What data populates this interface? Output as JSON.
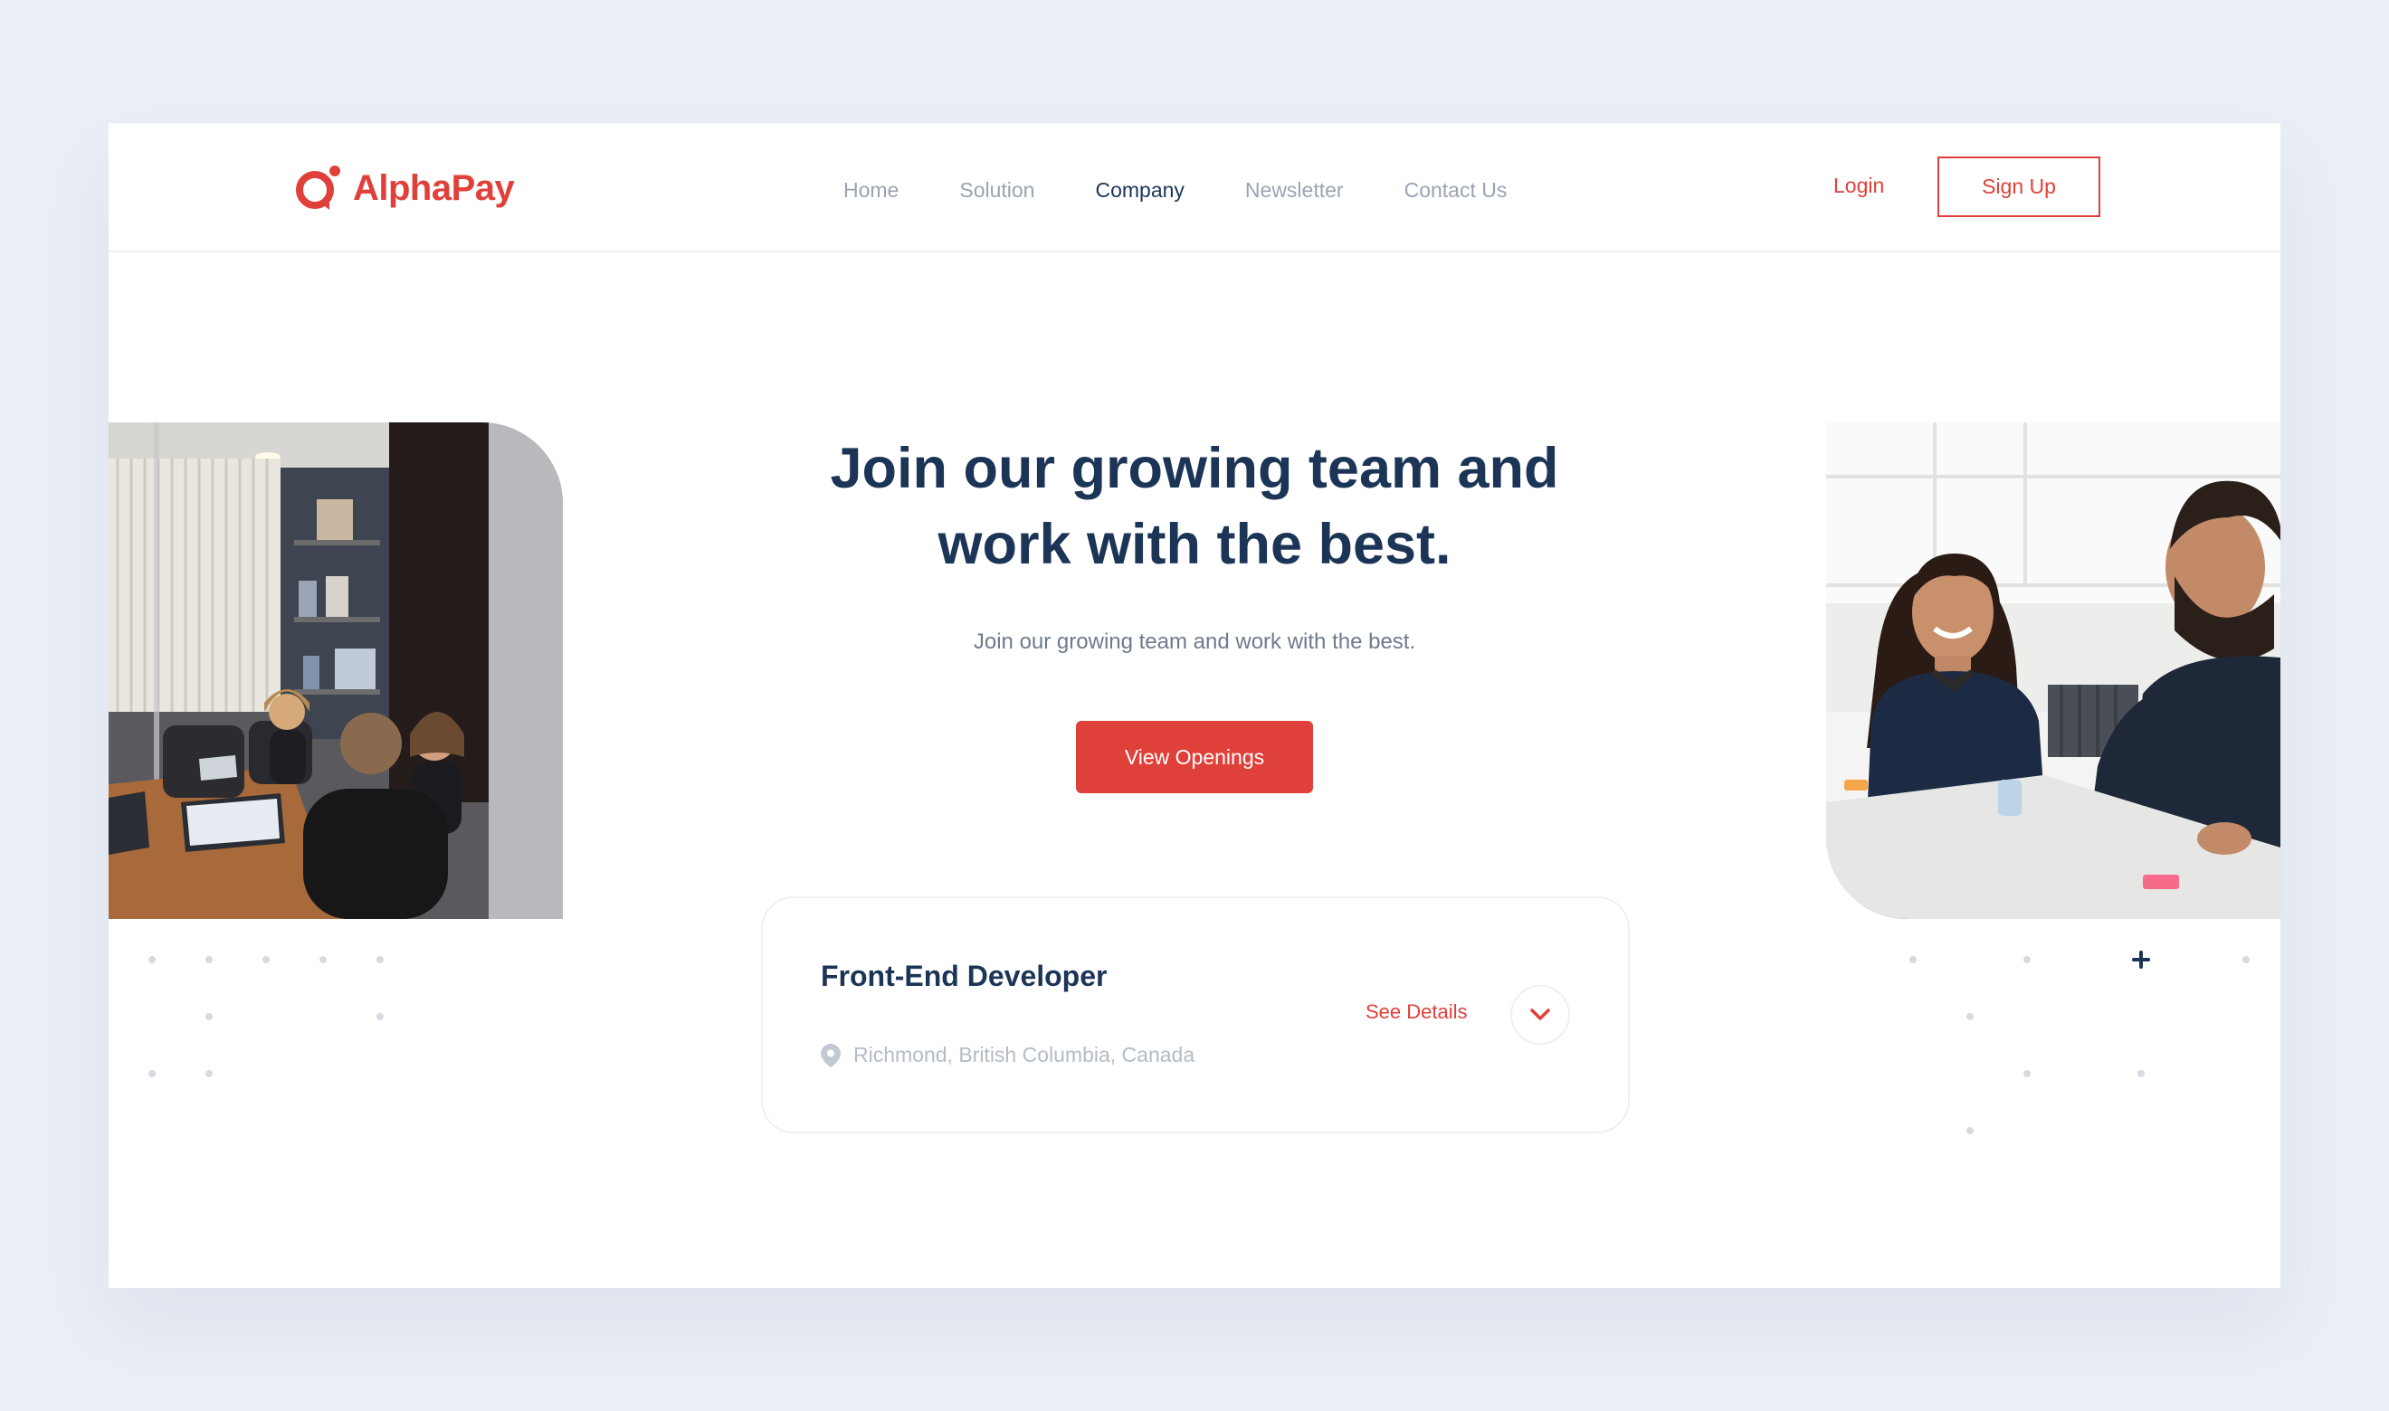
{
  "brand": {
    "name": "AlphaPay",
    "color": "#e0403a"
  },
  "nav": {
    "items": [
      {
        "label": "Home",
        "active": false
      },
      {
        "label": "Solution",
        "active": false
      },
      {
        "label": "Company",
        "active": true
      },
      {
        "label": "Newsletter",
        "active": false
      },
      {
        "label": "Contact Us",
        "active": false
      }
    ]
  },
  "auth": {
    "login_label": "Login",
    "signup_label": "Sign Up"
  },
  "hero": {
    "headline_line1": "Join our growing team and",
    "headline_line2": "work with the best.",
    "subheading": "Join our growing team and work with the best.",
    "cta_label": "View Openings"
  },
  "job": {
    "title": "Front-End Developer",
    "location": "Richmond, British Columbia, Canada",
    "details_label": "See Details",
    "expand_icon": "chevron-down-icon",
    "location_icon": "map-pin-icon"
  },
  "colors": {
    "accent": "#e0403a",
    "heading": "#1c3557",
    "muted": "#9aa3b2",
    "background": "#eaeef6"
  }
}
